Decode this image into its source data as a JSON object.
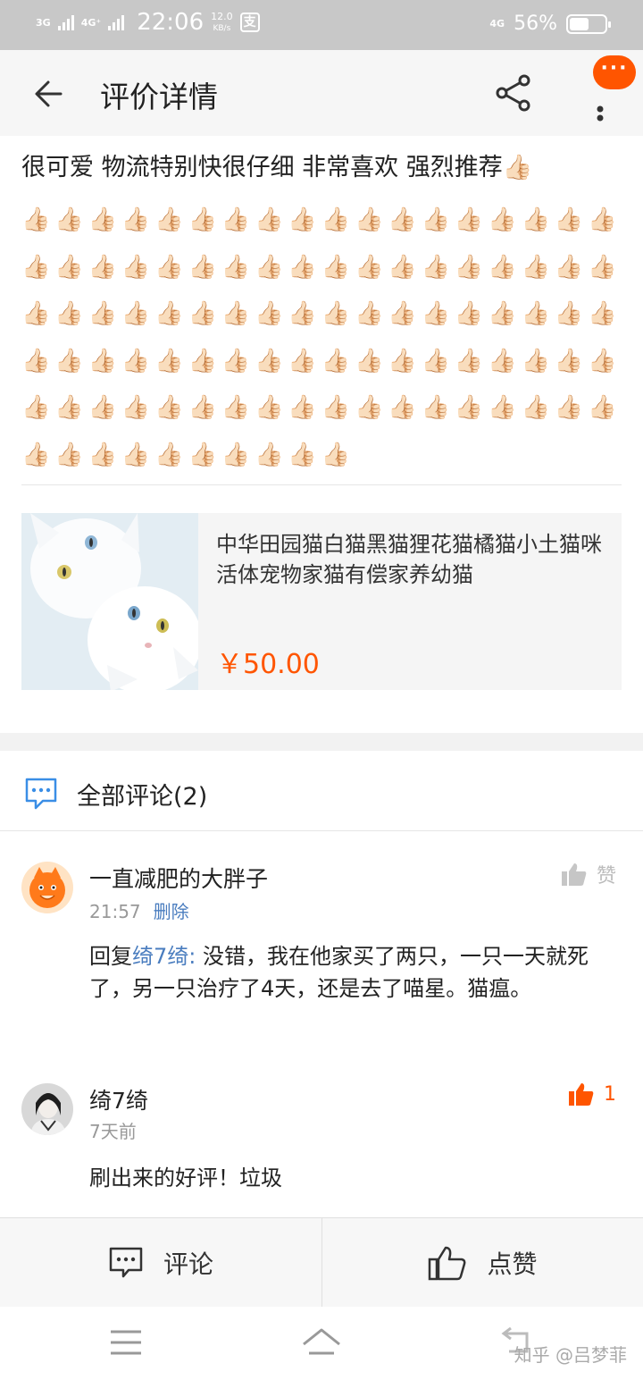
{
  "status_bar": {
    "network_left": "3G",
    "network_left2": "4G⁺",
    "time": "22:06",
    "speed_value": "12.0",
    "speed_unit": "KB/s",
    "pay_icon": "支",
    "network_right": "4G",
    "battery_pct": "56%",
    "battery_level": 0.56
  },
  "header": {
    "title": "评价详情",
    "more_badge": "···"
  },
  "review": {
    "text": "很可爱  物流特别快很仔细  非常喜欢   强烈推荐👍🏻",
    "thumb_emoji": "👍🏻",
    "thumb_count": 100
  },
  "product": {
    "title": "中华田园猫白猫黑猫狸花猫橘猫小土猫咪活体宠物家猫有偿家养幼猫",
    "price": "￥50.00"
  },
  "comments": {
    "title": "全部评论(2)",
    "items": [
      {
        "name": "一直减肥的大胖子",
        "time": "21:57",
        "delete_label": "删除",
        "reply_prefix": "回复",
        "reply_to": "绮7绮:",
        "body": " 没错，我在他家买了两只，一只一天就死了，另一只治疗了4天，还是去了喵星。猫瘟。",
        "like_label": "赞"
      },
      {
        "name": "绮7绮",
        "time": "7天前",
        "body": "刷出来的好评！垃圾",
        "like_count": "1"
      }
    ]
  },
  "action_bar": {
    "comment_label": "评论",
    "like_label": "点赞"
  },
  "watermark": "知乎 @吕梦菲",
  "colors": {
    "accent": "#ff5500",
    "link": "#4a7dbf",
    "status_bar": "#c8c8c8"
  }
}
